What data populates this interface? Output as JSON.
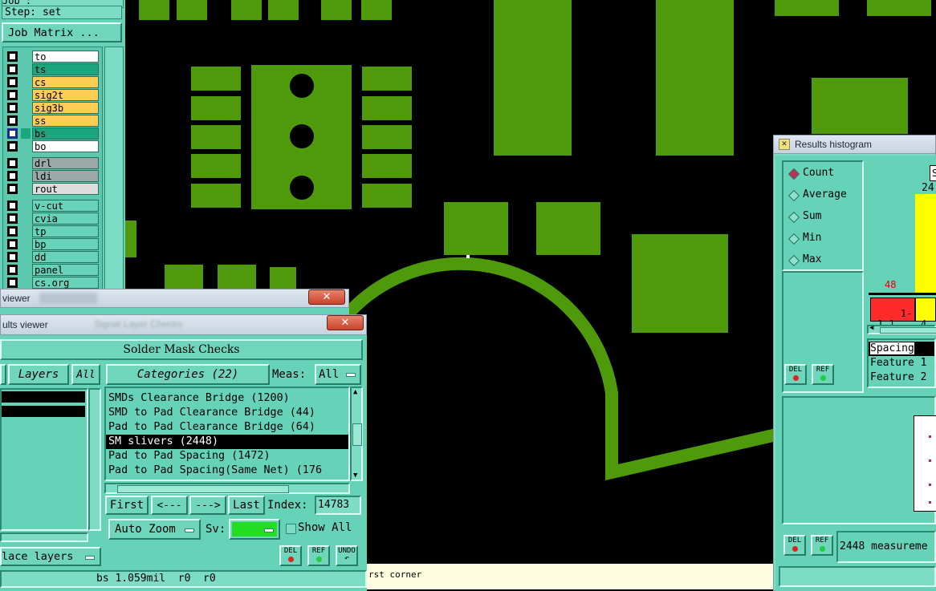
{
  "left_panel": {
    "title_fragment": "Job : ",
    "step_label": "Step: set",
    "job_matrix_button": "Job Matrix ...",
    "layers": [
      {
        "name": "to",
        "color": "#ffffff"
      },
      {
        "name": "ts",
        "color": "#1ba67e"
      },
      {
        "name": "cs",
        "color": "#ffcc55"
      },
      {
        "name": "sig2t",
        "color": "#ffcc55"
      },
      {
        "name": "sig3b",
        "color": "#ffcc55"
      },
      {
        "name": "ss",
        "color": "#ffcc55"
      },
      {
        "name": "bs",
        "color": "#1ba67e"
      },
      {
        "name": "bo",
        "color": "#ffffff"
      },
      {
        "name": "drl",
        "color": "#9aa8a8"
      },
      {
        "name": "ldi",
        "color": "#9aa8a8"
      },
      {
        "name": "rout",
        "color": "#dddddd"
      },
      {
        "name": "v-cut",
        "color": "#66d2b8"
      },
      {
        "name": "cvia",
        "color": "#66d2b8"
      },
      {
        "name": "tp",
        "color": "#66d2b8"
      },
      {
        "name": "bp",
        "color": "#66d2b8"
      },
      {
        "name": "dd",
        "color": "#66d2b8"
      },
      {
        "name": "panel",
        "color": "#66d2b8"
      },
      {
        "name": "cs.org",
        "color": "#66d2b8"
      }
    ]
  },
  "back_window": {
    "title": "viewer"
  },
  "results_viewer": {
    "title": "ults viewer",
    "title_blurred": "Signal Layer Checks",
    "header": "Solder Mask Checks",
    "layers_label": "Layers",
    "all_label": "All",
    "categories_label": "Categories (22)",
    "meas_label": "Meas:",
    "meas_value": "All",
    "categories": [
      "SMDs Clearance Bridge (1200)",
      "SMD to Pad Clearance Bridge (44)",
      "Pad to Pad Clearance Bridge (64)",
      "SM slivers (2448)",
      "Pad to Pad Spacing (1472)",
      "Pad to Pad Spacing(Same Net) (176"
    ],
    "selected_index": 3,
    "first": "First",
    "prev": "<---",
    "next": "--->",
    "last": "Last",
    "index_label": "Index:",
    "index_value": "14783",
    "auto_zoom": "Auto Zoom",
    "sv_label": "Sv:",
    "sv_color": "#22dd22",
    "show_all": "Show All",
    "place_layers": "lace layers",
    "del": "DEL",
    "ref": "REF",
    "undo": "UNDO",
    "status": "bs 1.059mil  r0  r0"
  },
  "prompt_bar": {
    "text": "rst corner"
  },
  "histogram": {
    "title": "Results histogram",
    "options": [
      "Count",
      "Average",
      "Sum",
      "Min",
      "Max"
    ],
    "selected": "Count",
    "del": "DEL",
    "ref": "REF",
    "top_number": "24",
    "left_bar_value": "48",
    "bin1": "1-\n1.1",
    "bin2": "4-\n4",
    "info": [
      "Spacing",
      "Feature 1",
      "Feature 2"
    ],
    "measurements": "2448 measureme",
    "box_label": "S"
  }
}
